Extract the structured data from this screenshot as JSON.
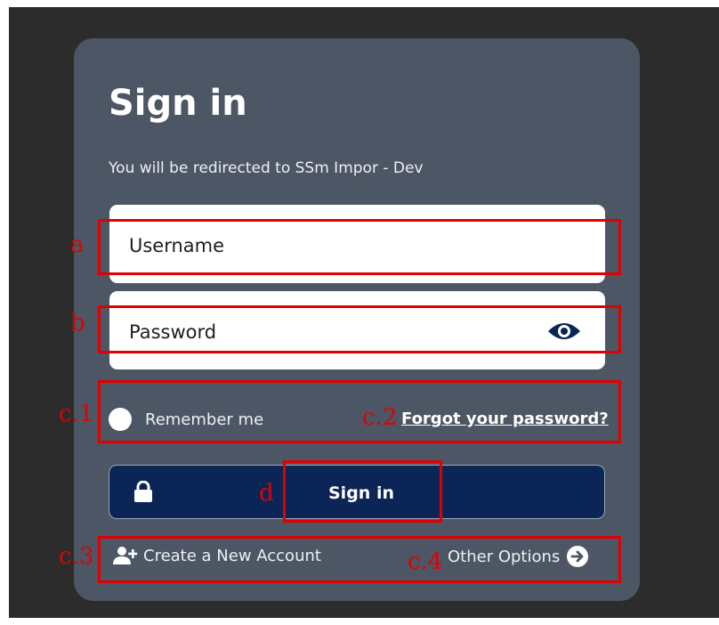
{
  "form": {
    "title": "Sign in",
    "subtitle": "You will be redirected to SSm Impor - Dev",
    "username_placeholder": "Username",
    "password_placeholder": "Password",
    "remember_label": "Remember me",
    "forgot_label": "Forgot your password?",
    "signin_label": "Sign in",
    "create_account_label": "Create a New Account",
    "other_options_label": "Other Options"
  },
  "icons": {
    "password_toggle": "eye-icon",
    "signin": "lock-icon",
    "create_account": "add-user-icon",
    "other_options": "arrow-right-circle-icon"
  },
  "annotations": {
    "a": "a",
    "b": "b",
    "c1": "c.1",
    "c2": "c.2",
    "d": "d",
    "c3": "c.3",
    "c4": "c.4"
  },
  "colors": {
    "backdrop": "#2c2c2c",
    "card": "#4d5664",
    "button": "#0b2556",
    "annotation": "#e00000"
  }
}
